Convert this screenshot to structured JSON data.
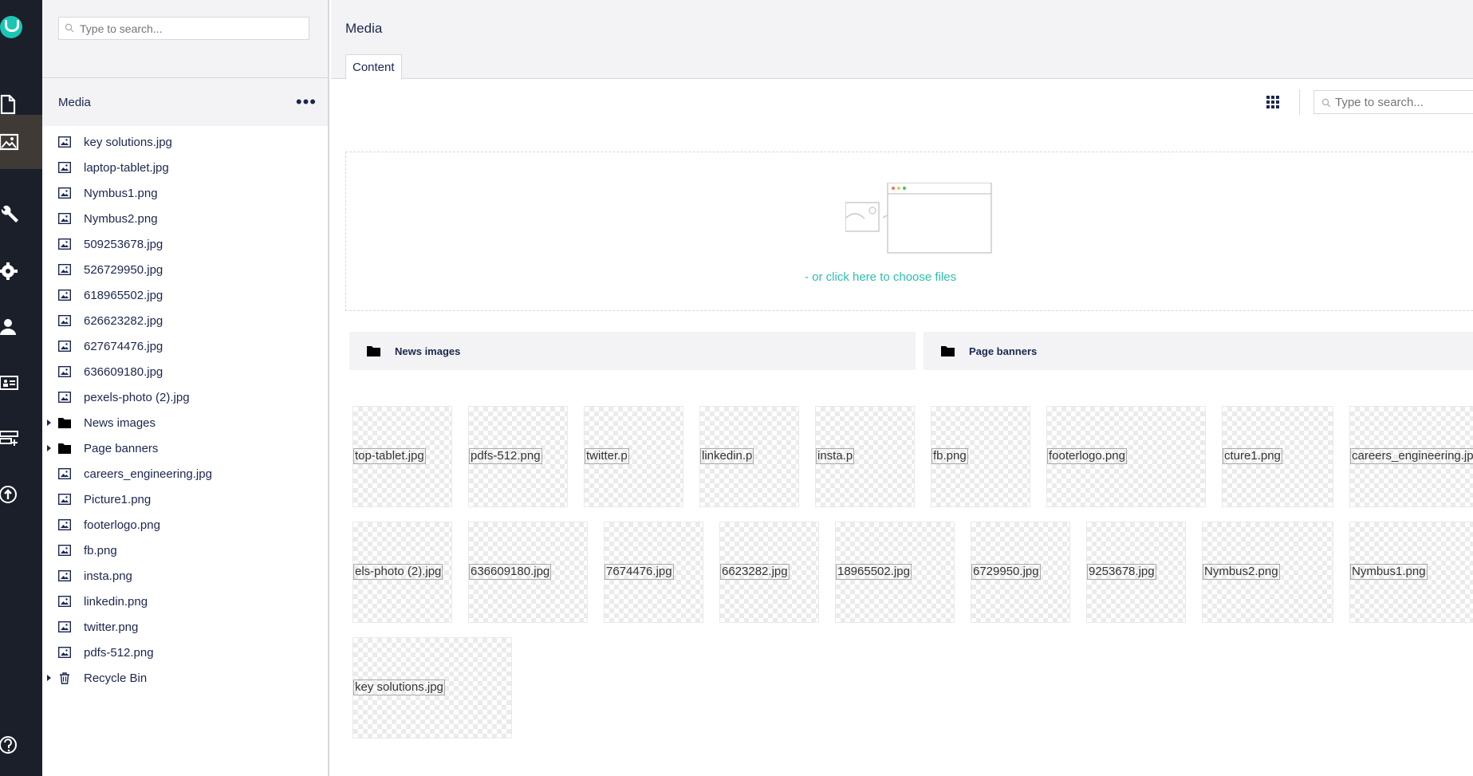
{
  "tree": {
    "search_placeholder": "Type to search...",
    "section_title": "Media",
    "more_label": "•••",
    "items": [
      {
        "label": "key solutions.jpg",
        "type": "image"
      },
      {
        "label": "laptop-tablet.jpg",
        "type": "image"
      },
      {
        "label": "Nymbus1.png",
        "type": "image"
      },
      {
        "label": "Nymbus2.png",
        "type": "image"
      },
      {
        "label": "509253678.jpg",
        "type": "image"
      },
      {
        "label": "526729950.jpg",
        "type": "image"
      },
      {
        "label": "618965502.jpg",
        "type": "image"
      },
      {
        "label": "626623282.jpg",
        "type": "image"
      },
      {
        "label": "627674476.jpg",
        "type": "image"
      },
      {
        "label": "636609180.jpg",
        "type": "image"
      },
      {
        "label": "pexels-photo (2).jpg",
        "type": "image"
      },
      {
        "label": "News images",
        "type": "folder"
      },
      {
        "label": "Page banners",
        "type": "folder"
      },
      {
        "label": "careers_engineering.jpg",
        "type": "image"
      },
      {
        "label": "Picture1.png",
        "type": "image"
      },
      {
        "label": "footerlogo.png",
        "type": "image"
      },
      {
        "label": "fb.png",
        "type": "image"
      },
      {
        "label": "insta.png",
        "type": "image"
      },
      {
        "label": "linkedin.png",
        "type": "image"
      },
      {
        "label": "twitter.png",
        "type": "image"
      },
      {
        "label": "pdfs-512.png",
        "type": "image"
      },
      {
        "label": "Recycle Bin",
        "type": "bin"
      }
    ]
  },
  "main": {
    "title": "Media",
    "tab_label": "Content",
    "search_placeholder": "Type to search...",
    "dropzone_link": "- or click here to choose files",
    "folders": [
      "News images",
      "Page banners"
    ],
    "tiles_row1": [
      "top-tablet.jpg",
      "pdfs-512.png",
      "twitter.p",
      "linkedin.p",
      "insta.p",
      "fb.png",
      "footerlogo.png",
      "cture1.png",
      "careers_engineering.jpg"
    ],
    "tiles_row2": [
      "els-photo (2).jpg",
      "636609180.jpg",
      "7674476.jpg",
      "6623282.jpg",
      "18965502.jpg",
      "6729950.jpg",
      "9253678.jpg",
      "Nymbus2.png",
      "Nymbus1.png"
    ],
    "tiles_row3": [
      "key solutions.jpg"
    ]
  },
  "icons": {
    "rail": [
      "logo-icon",
      "content-icon",
      "media-icon",
      "settings-wrench-icon",
      "gear-icon",
      "user-icon",
      "members-icon",
      "forms-icon",
      "deploy-icon",
      "help-icon"
    ]
  },
  "colors": {
    "rail_bg": "#1b1f2a",
    "rail_active": "#3f3a36",
    "accent": "#1bc5b4",
    "link": "#2bc0b0",
    "panel_bg": "#f3f3f5"
  }
}
